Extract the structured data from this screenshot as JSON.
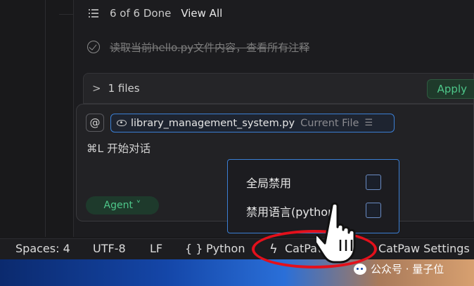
{
  "todo": {
    "count_label": "6 of 6 Done",
    "view_all_label": "View All"
  },
  "task": {
    "text": "读取当前hello.py文件内容，查看所有注释"
  },
  "files_bar": {
    "label": "1 files",
    "apply_label": "Apply"
  },
  "input": {
    "at_label": "@",
    "chip_file": "library_management_system.py",
    "chip_tag": "Current File",
    "shortcut_hint": "⌘L 开始对话",
    "mode_label": "Agent ˅"
  },
  "menu": {
    "items": [
      {
        "label": "全局禁用",
        "checked": false
      },
      {
        "label": "禁用语言(python)",
        "checked": false
      }
    ]
  },
  "status_bar": {
    "spaces": "Spaces: 4",
    "encoding": "UTF-8",
    "eol": "LF",
    "language_icon": "{ }",
    "language": "Python",
    "catpaw": "CatPaw",
    "catpaw_settings": "CatPaw Settings"
  },
  "watermark": {
    "text": "公众号 · 量子位"
  },
  "colors": {
    "accent": "#3b7fd4",
    "green": "#4ec78a",
    "highlight_red": "#e3101b"
  }
}
